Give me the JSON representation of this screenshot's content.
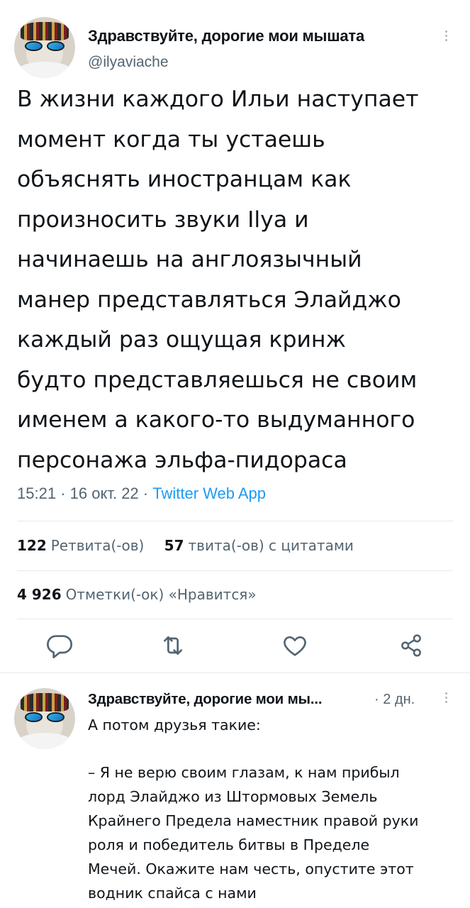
{
  "main_tweet": {
    "author_name": "Здравствуйте, дорогие мои мышата",
    "author_handle": "@ilyaviache",
    "text_lines": [
      "В жизни каждого Ильи наступает",
      "момент когда ты устаешь",
      "объяснять иностранцам как",
      "произносить звуки Ilya и",
      "начинаешь на англоязычный",
      "манер представляться Элайджо",
      "каждый раз ощущая кринж",
      "будто представляешься не своим",
      "именем а какого-то выдуманного",
      "персонажа эльфа-пидораса"
    ],
    "time": "15:21",
    "date": "16 окт. 22",
    "separator": "·",
    "source": "Twitter Web App",
    "retweets_count": "122",
    "retweets_label": "Ретвита(-ов)",
    "quotes_count": "57",
    "quotes_label": "твита(-ов) с цитатами",
    "likes_count": "4 926",
    "likes_label": "Отметки(-ок) «Нравится»"
  },
  "actions": [
    {
      "name": "reply",
      "icon": "reply-icon"
    },
    {
      "name": "retweet",
      "icon": "retweet-icon"
    },
    {
      "name": "like",
      "icon": "heart-icon"
    },
    {
      "name": "share",
      "icon": "share-icon"
    }
  ],
  "reply_tweet": {
    "author_name": "Здравствуйте, дорогие мои мы...",
    "time_ago": "· 2 дн.",
    "first_line": "А потом друзья такие:",
    "quote_lines": [
      "– Я не верю своим глазам, к нам прибыл",
      "лорд Элайджо из Штормовых Земель",
      "Крайнего Предела наместник правой руки",
      "роля и победитель битвы в Пределе",
      "Мечей. Окажите нам честь, опустите этот",
      "водник спайса с нами"
    ]
  },
  "colors": {
    "text": "#0f1419",
    "secondary": "#536471",
    "link": "#1d9bf0",
    "divider": "#e7e9ea"
  }
}
